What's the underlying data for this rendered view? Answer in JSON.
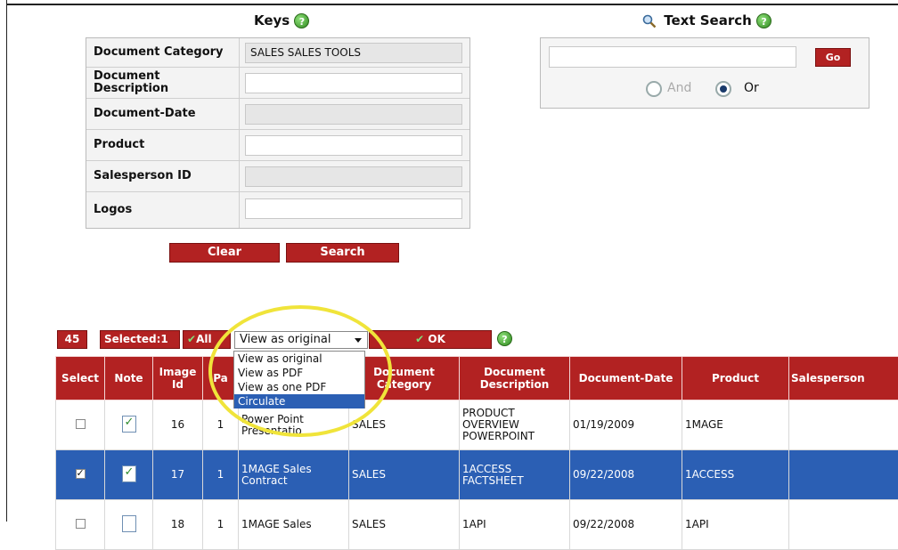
{
  "keys": {
    "title": "Keys",
    "rows": [
      {
        "label": "Document Category",
        "value": "SALES  SALES TOOLS"
      },
      {
        "label": "Document Description",
        "value": ""
      },
      {
        "label": "Document-Date",
        "value": ""
      },
      {
        "label": "Product",
        "value": ""
      },
      {
        "label": "Salesperson ID",
        "value": ""
      },
      {
        "label": "Logos",
        "value": ""
      }
    ],
    "clear_label": "Clear",
    "search_label": "Search"
  },
  "text_search": {
    "title": "Text Search",
    "go_label": "Go",
    "and_label": "And",
    "or_label": "Or",
    "selected": "Or"
  },
  "toolbar": {
    "count": "45",
    "selected": "Selected:1",
    "all_label": "All",
    "view_value": "View as original",
    "ok_label": "OK",
    "options": [
      "View as original",
      "View as PDF",
      "View as one PDF",
      "Circulate"
    ],
    "highlighted_option": "Circulate"
  },
  "table": {
    "headers": [
      "Select",
      "Note",
      "Image Id",
      "Pa",
      "Document Category",
      "Document Description",
      "Document-Date",
      "Product",
      "Salesperson"
    ],
    "rows": [
      {
        "selected": false,
        "note": "checked",
        "image_id": "16",
        "page": "1",
        "title": "Power Point Presentatio",
        "category": "SALES",
        "description": "PRODUCT OVERVIEW POWERPOINT",
        "date": "01/19/2009",
        "product": "1MAGE",
        "salesperson": ""
      },
      {
        "selected": true,
        "note": "checked",
        "image_id": "17",
        "page": "1",
        "title": "1MAGE Sales Contract",
        "category": "SALES",
        "description": "1ACCESS FACTSHEET",
        "date": "09/22/2008",
        "product": "1ACCESS",
        "salesperson": ""
      },
      {
        "selected": false,
        "note": "blank",
        "image_id": "18",
        "page": "1",
        "title": "1MAGE Sales",
        "category": "SALES",
        "description": "1API",
        "date": "09/22/2008",
        "product": "1API",
        "salesperson": ""
      }
    ]
  },
  "colors": {
    "accent_red": "#b22222",
    "selection_blue": "#2b5fb4",
    "help_green": "#3ea12a",
    "ring_yellow": "#f0e43a"
  }
}
